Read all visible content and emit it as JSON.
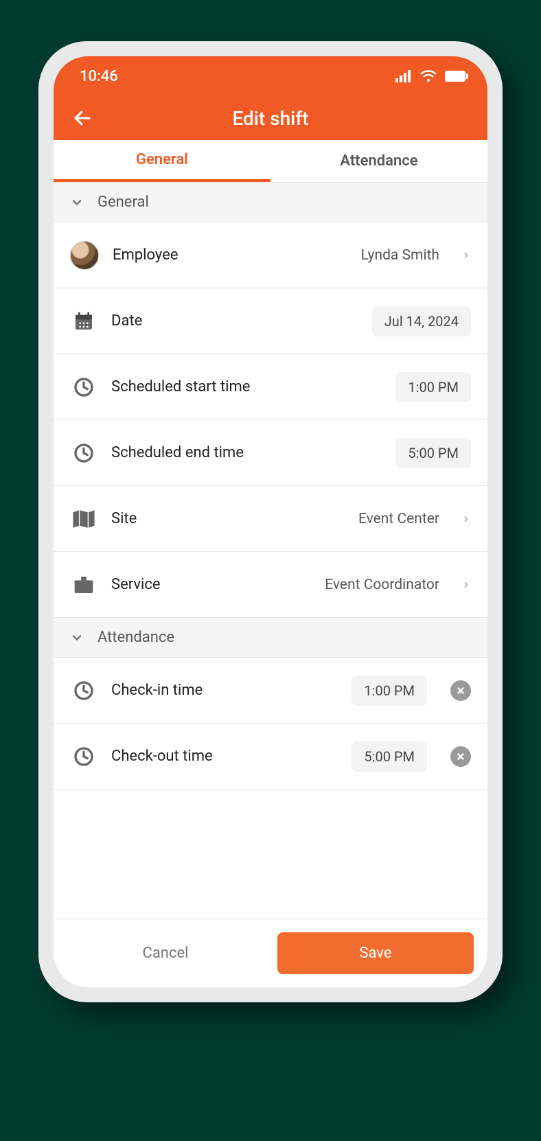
{
  "status": {
    "time": "10:46"
  },
  "nav": {
    "title": "Edit shift"
  },
  "tabs": {
    "general": "General",
    "attendance": "Attendance"
  },
  "sections": {
    "general_header": "General",
    "attendance_header": "Attendance"
  },
  "general": {
    "employee_label": "Employee",
    "employee_value": "Lynda Smith",
    "date_label": "Date",
    "date_value": "Jul 14, 2024",
    "start_label": "Scheduled start time",
    "start_value": "1:00 PM",
    "end_label": "Scheduled end time",
    "end_value": "5:00 PM",
    "site_label": "Site",
    "site_value": "Event Center",
    "service_label": "Service",
    "service_value": "Event Coordinator"
  },
  "attendance": {
    "checkin_label": "Check-in time",
    "checkin_value": "1:00 PM",
    "checkout_label": "Check-out time",
    "checkout_value": "5:00 PM"
  },
  "footer": {
    "cancel": "Cancel",
    "save": "Save"
  }
}
